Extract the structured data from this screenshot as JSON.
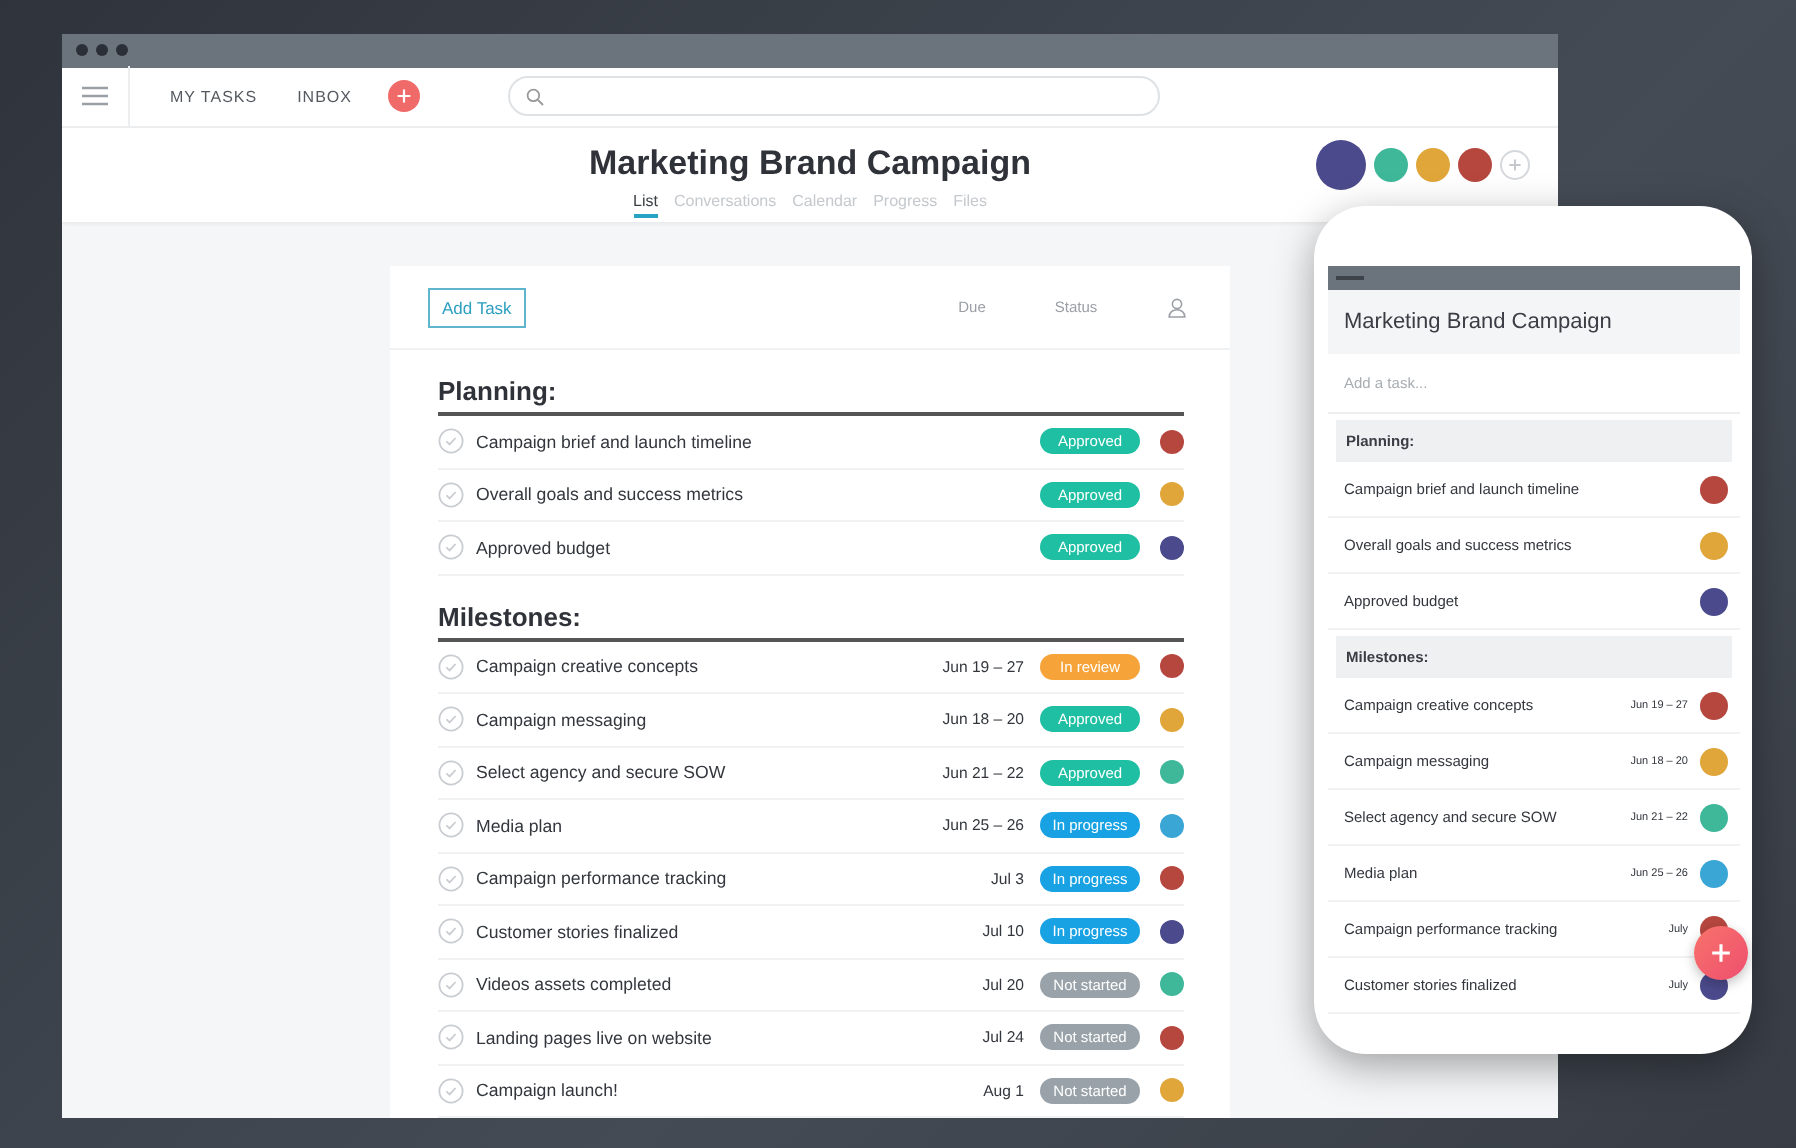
{
  "nav": {
    "items": [
      "MY TASKS",
      "INBOX"
    ]
  },
  "project": {
    "title": "Marketing Brand Campaign",
    "tabs": [
      {
        "label": "List",
        "selected": true
      },
      {
        "label": "Conversations",
        "selected": false
      },
      {
        "label": "Calendar",
        "selected": false
      },
      {
        "label": "Progress",
        "selected": false
      },
      {
        "label": "Files",
        "selected": false
      }
    ],
    "members": [
      {
        "color": "#4b4a8c"
      },
      {
        "color": "#3fb89a"
      },
      {
        "color": "#e0a63a"
      },
      {
        "color": "#b5473f"
      }
    ]
  },
  "list": {
    "add_button": "Add Task",
    "columns": [
      "Due",
      "Status"
    ],
    "sections": [
      {
        "title": "Planning:",
        "tasks": [
          {
            "name": "Campaign brief and launch timeline",
            "status": {
              "kind": "approved",
              "label": "Approved"
            },
            "color": "#b5473f"
          },
          {
            "name": "Overall goals and success metrics",
            "status": {
              "kind": "approved",
              "label": "Approved"
            },
            "color": "#e0a63a"
          },
          {
            "name": "Approved budget",
            "status": {
              "kind": "approved",
              "label": "Approved"
            },
            "color": "#4b4a8c"
          }
        ]
      },
      {
        "title": "Milestones:",
        "tasks": [
          {
            "name": "Campaign creative concepts",
            "due": "Jun 19 – 27",
            "status": {
              "kind": "in_review",
              "label": "In review"
            },
            "color": "#b5473f"
          },
          {
            "name": "Campaign messaging",
            "due": "Jun 18 – 20",
            "status": {
              "kind": "approved",
              "label": "Approved"
            },
            "color": "#e0a63a"
          },
          {
            "name": "Select agency and secure SOW",
            "due": "Jun 21 – 22",
            "status": {
              "kind": "approved",
              "label": "Approved"
            },
            "color": "#3fb89a"
          },
          {
            "name": "Media plan",
            "due": "Jun 25 – 26",
            "status": {
              "kind": "in_progress",
              "label": "In progress"
            },
            "color": "#3aa6d6"
          },
          {
            "name": "Campaign performance tracking",
            "due": "Jul 3",
            "status": {
              "kind": "in_progress",
              "label": "In progress"
            },
            "color": "#b5473f"
          },
          {
            "name": "Customer stories finalized",
            "due": "Jul 10",
            "status": {
              "kind": "in_progress",
              "label": "In progress"
            },
            "color": "#4b4a8c"
          },
          {
            "name": "Videos assets completed",
            "due": "Jul 20",
            "status": {
              "kind": "not_started",
              "label": "Not started"
            },
            "color": "#3fb89a"
          },
          {
            "name": "Landing pages live on website",
            "due": "Jul 24",
            "status": {
              "kind": "not_started",
              "label": "Not started"
            },
            "color": "#b5473f"
          },
          {
            "name": "Campaign launch!",
            "due": "Aug 1",
            "status": {
              "kind": "not_started",
              "label": "Not started"
            },
            "color": "#e0a63a"
          }
        ]
      }
    ]
  },
  "mobile": {
    "title": "Marketing Brand Campaign",
    "placeholder": "Add a task...",
    "sections": [
      {
        "title": "Planning:",
        "tasks": [
          {
            "name": "Campaign brief and launch timeline",
            "color": "#b5473f"
          },
          {
            "name": "Overall goals and success metrics",
            "color": "#e0a63a"
          },
          {
            "name": "Approved budget",
            "color": "#4b4a8c"
          }
        ]
      },
      {
        "title": "Milestones:",
        "tasks": [
          {
            "name": "Campaign creative concepts",
            "due": "Jun 19 – 27",
            "color": "#b5473f"
          },
          {
            "name": "Campaign messaging",
            "due": "Jun 18 – 20",
            "color": "#e0a63a"
          },
          {
            "name": "Select agency and secure SOW",
            "due": "Jun 21 – 22",
            "color": "#3fb89a"
          },
          {
            "name": "Media plan",
            "due": "Jun 25 – 26",
            "color": "#3aa6d6"
          },
          {
            "name": "Campaign performance tracking",
            "due": "July",
            "color": "#b5473f"
          },
          {
            "name": "Customer stories finalized",
            "due": "July",
            "color": "#4b4a8c"
          }
        ]
      }
    ]
  }
}
